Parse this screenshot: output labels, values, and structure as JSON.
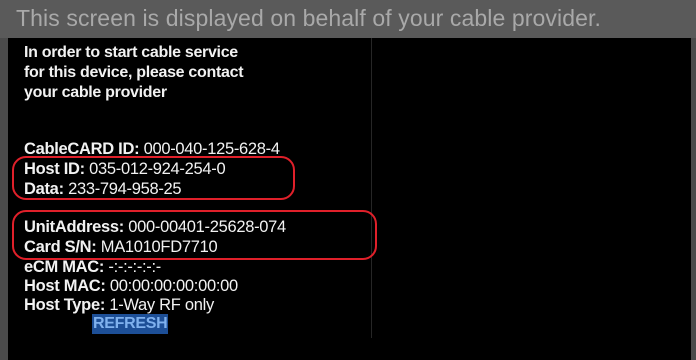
{
  "banner": {
    "text": "This screen is displayed on behalf of your cable provider."
  },
  "message": {
    "line1": "In order to start cable service",
    "line2": "for this device, please contact",
    "line3": "your cable provider"
  },
  "info": {
    "cablecard_id": {
      "label": "CableCARD ID:",
      "value": "000-040-125-628-4"
    },
    "host_id": {
      "label": "Host ID:",
      "value": "035-012-924-254-0"
    },
    "data": {
      "label": "Data:",
      "value": "233-794-958-25"
    },
    "unit_address": {
      "label": "UnitAddress:",
      "value": "000-00401-25628-074"
    },
    "card_sn": {
      "label": "Card S/N:",
      "value": "MA1010FD7710"
    },
    "ecm_mac": {
      "label": "eCM MAC:",
      "value": "-:-:-:-:-:-"
    },
    "host_mac": {
      "label": "Host MAC:",
      "value": "00:00:00:00:00:00"
    },
    "host_type": {
      "label": "Host Type:",
      "value": "1-Way RF only"
    }
  },
  "actions": {
    "refresh_label": "REFRESH"
  },
  "colors": {
    "highlight_circle": "#e0202a",
    "button_bg": "#1d4f97",
    "button_text": "#7fb1ee"
  }
}
